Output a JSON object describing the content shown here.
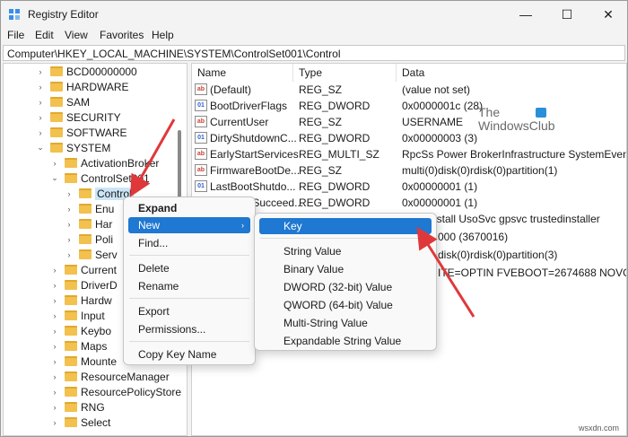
{
  "window": {
    "title": "Registry Editor",
    "minimize_glyph": "—",
    "maximize_glyph": "☐",
    "close_glyph": "✕"
  },
  "menu": [
    "File",
    "Edit",
    "View",
    "Favorites",
    "Help"
  ],
  "address": "Computer\\HKEY_LOCAL_MACHINE\\SYSTEM\\ControlSet001\\Control",
  "tree": [
    {
      "label": "BCD00000000",
      "chev": "›"
    },
    {
      "label": "HARDWARE",
      "chev": "›"
    },
    {
      "label": "SAM",
      "chev": "›"
    },
    {
      "label": "SECURITY",
      "chev": "›"
    },
    {
      "label": "SOFTWARE",
      "chev": "›"
    },
    {
      "label": "SYSTEM",
      "chev": "⌄"
    },
    {
      "label": "ActivationBroker",
      "chev": "›"
    },
    {
      "label": "ControlSet001",
      "chev": "⌄"
    },
    {
      "label": "Control",
      "chev": "›",
      "selected": true
    },
    {
      "label": "Enu",
      "chev": "›"
    },
    {
      "label": "Har",
      "chev": "›"
    },
    {
      "label": "Poli",
      "chev": "›"
    },
    {
      "label": "Serv",
      "chev": "›"
    },
    {
      "label": "Current",
      "chev": "›"
    },
    {
      "label": "DriverD",
      "chev": "›"
    },
    {
      "label": "Hardw",
      "chev": "›"
    },
    {
      "label": "Input",
      "chev": "›"
    },
    {
      "label": "Keybo",
      "chev": "›"
    },
    {
      "label": "Maps",
      "chev": "›"
    },
    {
      "label": "Mounte",
      "chev": "›"
    },
    {
      "label": "ResourceManager",
      "chev": "›"
    },
    {
      "label": "ResourcePolicyStore",
      "chev": "›"
    },
    {
      "label": "RNG",
      "chev": "›"
    },
    {
      "label": "Select",
      "chev": "›"
    }
  ],
  "list": {
    "headers": [
      "Name",
      "Type",
      "Data"
    ],
    "rows": [
      {
        "icon": "ab",
        "name": "(Default)",
        "type": "REG_SZ",
        "data": "(value not set)"
      },
      {
        "icon": "bin",
        "name": "BootDriverFlags",
        "type": "REG_DWORD",
        "data": "0x0000001c (28)"
      },
      {
        "icon": "ab",
        "name": "CurrentUser",
        "type": "REG_SZ",
        "data": "USERNAME"
      },
      {
        "icon": "bin",
        "name": "DirtyShutdownC...",
        "type": "REG_DWORD",
        "data": "0x00000003 (3)"
      },
      {
        "icon": "ab",
        "name": "EarlyStartServices",
        "type": "REG_MULTI_SZ",
        "data": "RpcSs Power BrokerInfrastructure SystemEventsBro"
      },
      {
        "icon": "ab",
        "name": "FirmwareBootDe...",
        "type": "REG_SZ",
        "data": "multi(0)disk(0)rdisk(0)partition(1)"
      },
      {
        "icon": "bin",
        "name": "LastBootShutdo...",
        "type": "REG_DWORD",
        "data": "0x00000001 (1)"
      },
      {
        "icon": "bin",
        "name": "LastBootSucceed...",
        "type": "REG_DWORD",
        "data": "0x00000001 (1)"
      },
      {
        "icon": "ab",
        "name": "",
        "type": "",
        "data": "nstall UsoSvc gpsvc trustedinstaller"
      },
      {
        "icon": "bin",
        "name": "",
        "type": "",
        "data": "000 (3670016)"
      },
      {
        "icon": "ab",
        "name": "",
        "type": "",
        "data": "disk(0)rdisk(0)partition(3)"
      },
      {
        "icon": "ab",
        "name": "",
        "type": "",
        "data": "ITE=OPTIN  FVEBOOT=2674688  NOVGA"
      }
    ]
  },
  "watermark": {
    "line1": "The",
    "line2": "WindowsClub"
  },
  "context_menu": {
    "items": [
      "Expand",
      "New",
      "Find...",
      "Delete",
      "Rename",
      "Export",
      "Permissions...",
      "Copy Key Name"
    ],
    "submenu_arrow": "›"
  },
  "submenu": {
    "items": [
      "Key",
      "String Value",
      "Binary Value",
      "DWORD (32-bit) Value",
      "QWORD (64-bit) Value",
      "Multi-String Value",
      "Expandable String Value"
    ]
  },
  "footer": "wsxdn.com",
  "colors": {
    "highlight": "#1f78d1",
    "arrow": "#e0383a",
    "folder": "#f2c14e"
  }
}
